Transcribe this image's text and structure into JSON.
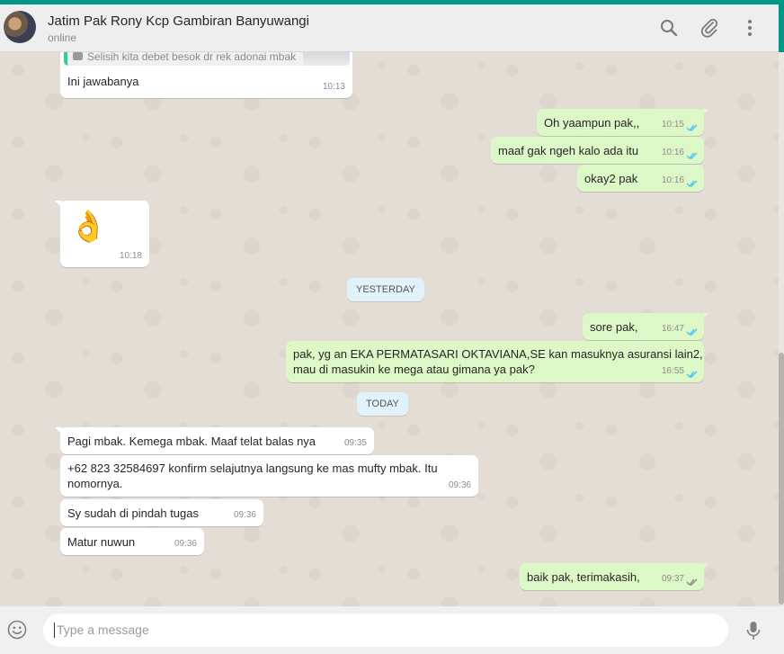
{
  "header": {
    "contact_name": "Jatim Pak Rony Kcp Gambiran Banyuwangi",
    "status": "online"
  },
  "icons": {
    "search": "search-icon",
    "attach": "paperclip-icon",
    "menu": "more-vertical-icon",
    "emoji": "smiley-icon",
    "mic": "microphone-icon"
  },
  "messages": [
    {
      "quote": "Selisih kita debet besok dr rek adonai mbak",
      "text": "Ini jawabanya",
      "time": "10:13",
      "dir": "in"
    },
    {
      "text": "Oh yaampun pak,,",
      "time": "10:15",
      "dir": "out"
    },
    {
      "text": "maaf gak ngeh kalo ada itu",
      "time": "10:16",
      "dir": "out"
    },
    {
      "text": "okay2 pak",
      "time": "10:16",
      "dir": "out"
    },
    {
      "text": "👌",
      "time": "10:18",
      "dir": "in"
    },
    {
      "text": "sore pak,",
      "time": "16:47",
      "dir": "out"
    },
    {
      "text_lines": [
        "pak, yg an EKA PERMATASARI OKTAVIANA,SE kan masuknya asuransi lain2,",
        "mau di masukin ke mega atau gimana ya pak?"
      ],
      "time": "16:55",
      "dir": "out"
    },
    {
      "text": "Pagi mbak. Kemega mbak. Maaf telat balas nya",
      "time": "09:35",
      "dir": "in"
    },
    {
      "text_lines": [
        "+62 823 32584697 konfirm selajutnya langsung ke mas mufty mbak. Itu",
        "nomornya."
      ],
      "time": "09:36",
      "dir": "in"
    },
    {
      "text": "Sy sudah di pindah tugas",
      "time": "09:36",
      "dir": "in"
    },
    {
      "text": "Matur nuwun",
      "time": "09:36",
      "dir": "in"
    },
    {
      "text": "baik pak, terimakasih,",
      "time": "09:37",
      "dir": "out"
    }
  ],
  "day_separators": [
    "YESTERDAY",
    "TODAY"
  ],
  "composer": {
    "placeholder": "Type a message"
  },
  "colors": {
    "accent": "#009688",
    "outgoing_bubble": "#dcf8c6",
    "incoming_bubble": "#ffffff",
    "read_ticks": "#4fc3f7",
    "day_chip": "#e1f2fb"
  }
}
